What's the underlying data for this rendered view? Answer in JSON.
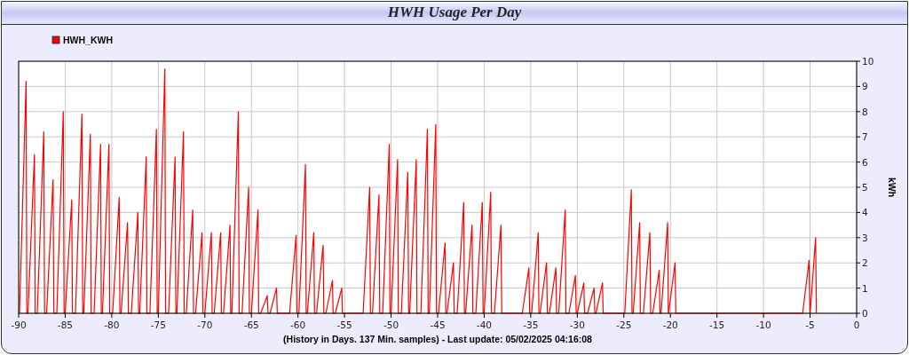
{
  "chart_data": {
    "type": "line",
    "grid": true,
    "title": "HWH Usage Per Day",
    "xlabel": "(History in Days. 137 Min. samples) - Last update: 05/02/2025 04:16:08",
    "ylabel": "kWh",
    "xlim": [
      -90,
      0
    ],
    "ylim": [
      0,
      10
    ],
    "xticks": [
      -90,
      -85,
      -80,
      -75,
      -70,
      -65,
      -60,
      -55,
      -50,
      -45,
      -40,
      -35,
      -30,
      -25,
      -20,
      -15,
      -10,
      -5,
      0
    ],
    "yticks": [
      0,
      1,
      2,
      3,
      4,
      5,
      6,
      7,
      8,
      9,
      10
    ],
    "x": [
      -89.9,
      -89.2,
      -89.12,
      -89.0,
      -88.3,
      -88.22,
      -88.0,
      -87.3,
      -87.22,
      -87.0,
      -86.3,
      -86.22,
      -85.9,
      -85.2,
      -85.12,
      -85.0,
      -84.3,
      -84.22,
      -83.9,
      -83.2,
      -83.12,
      -83.0,
      -82.3,
      -82.22,
      -81.9,
      -81.2,
      -81.12,
      -81.0,
      -80.3,
      -80.22,
      -79.9,
      -79.2,
      -79.12,
      -79.0,
      -78.3,
      -78.22,
      -77.9,
      -77.2,
      -77.12,
      -77.0,
      -76.3,
      -76.22,
      -75.9,
      -75.2,
      -75.12,
      -75.0,
      -74.3,
      -74.22,
      -73.9,
      -73.2,
      -73.12,
      -73.0,
      -72.3,
      -72.22,
      -72.0,
      -71.3,
      -71.22,
      -71.0,
      -70.3,
      -70.22,
      -70.0,
      -69.3,
      -69.22,
      -69.0,
      -68.3,
      -68.22,
      -68.0,
      -67.3,
      -67.22,
      -67.1,
      -66.4,
      -66.32,
      -66.0,
      -65.3,
      -65.22,
      -65.0,
      -64.3,
      -64.22,
      -64.0,
      -63.3,
      -63.22,
      -63.0,
      -62.3,
      -62.22,
      -60.9,
      -60.2,
      -60.12,
      -59.9,
      -59.2,
      -59.12,
      -59.0,
      -58.3,
      -58.22,
      -58.0,
      -57.3,
      -57.22,
      -57.0,
      -56.3,
      -56.22,
      -56.0,
      -55.3,
      -55.22,
      -53.0,
      -52.3,
      -52.22,
      -52.0,
      -51.3,
      -51.22,
      -50.9,
      -50.2,
      -50.12,
      -50.0,
      -49.3,
      -49.22,
      -48.9,
      -48.2,
      -48.12,
      -48.0,
      -47.3,
      -47.22,
      -46.8,
      -46.1,
      -46.02,
      -45.9,
      -45.2,
      -45.12,
      -44.9,
      -44.2,
      -44.12,
      -44.0,
      -43.3,
      -43.22,
      -42.9,
      -42.2,
      -42.12,
      -42.0,
      -41.3,
      -41.22,
      -40.9,
      -40.2,
      -40.12,
      -40.0,
      -39.3,
      -39.22,
      -38.9,
      -38.2,
      -38.12,
      -35.9,
      -35.2,
      -35.12,
      -34.9,
      -34.2,
      -34.12,
      -34.0,
      -33.3,
      -33.22,
      -33.0,
      -32.3,
      -32.22,
      -32.0,
      -31.3,
      -31.22,
      -30.9,
      -30.2,
      -30.12,
      -30.0,
      -29.3,
      -29.22,
      -28.9,
      -28.2,
      -28.12,
      -28.0,
      -27.3,
      -27.22,
      -24.9,
      -24.2,
      -24.12,
      -24.0,
      -23.3,
      -23.22,
      -22.9,
      -22.2,
      -22.12,
      -21.9,
      -21.2,
      -21.12,
      -21.0,
      -20.3,
      -20.22,
      -20.2,
      -19.5,
      -19.42,
      -5.8,
      -5.1,
      -5.02,
      -5.0,
      -4.4,
      -4.32
    ],
    "series": [
      {
        "name": "HWH_KWH",
        "color": "#ff0000",
        "values": [
          0,
          9.2,
          0,
          0,
          6.3,
          0,
          0,
          7.2,
          0,
          0,
          5.3,
          0,
          0,
          8.0,
          0,
          0,
          4.5,
          0,
          0,
          7.9,
          0,
          0,
          7.1,
          0,
          0,
          6.7,
          0,
          0,
          6.7,
          0,
          0,
          4.6,
          0,
          0,
          3.6,
          0,
          0,
          4.0,
          0,
          0,
          6.2,
          0,
          0,
          7.3,
          0,
          0,
          9.7,
          0,
          0,
          6.2,
          0,
          0,
          7.2,
          0,
          0,
          4.1,
          0,
          0,
          3.2,
          0,
          0,
          3.2,
          0,
          0,
          3.2,
          0,
          0,
          3.5,
          0,
          0,
          8.0,
          0,
          0,
          5.0,
          0,
          0,
          4.1,
          0,
          0,
          0.7,
          0,
          0,
          1.0,
          0,
          0,
          3.1,
          0,
          0,
          5.9,
          0,
          0,
          3.2,
          0,
          0,
          2.7,
          0,
          0,
          1.3,
          0,
          0,
          1.0,
          0,
          0,
          5.0,
          0,
          0,
          4.7,
          0,
          0,
          6.7,
          0,
          0,
          6.1,
          0,
          0,
          5.6,
          0,
          0,
          6.1,
          0,
          0,
          7.3,
          0,
          0,
          7.5,
          0,
          0,
          2.8,
          0,
          0,
          2.0,
          0,
          0,
          4.4,
          0,
          0,
          3.5,
          0,
          0,
          4.4,
          0,
          0,
          4.8,
          0,
          0,
          3.5,
          0,
          0,
          1.8,
          0,
          0,
          3.2,
          0,
          0,
          2.0,
          0,
          0,
          1.8,
          0,
          0,
          4.1,
          0,
          0,
          1.5,
          0,
          0,
          1.2,
          0,
          0,
          1.0,
          0,
          0,
          1.2,
          0,
          0,
          4.9,
          0,
          0,
          3.6,
          0,
          0,
          3.2,
          0,
          0,
          1.7,
          0,
          0,
          3.6,
          0,
          0,
          2.0,
          0,
          0,
          2.1,
          0,
          0,
          3.0,
          0
        ]
      }
    ]
  }
}
